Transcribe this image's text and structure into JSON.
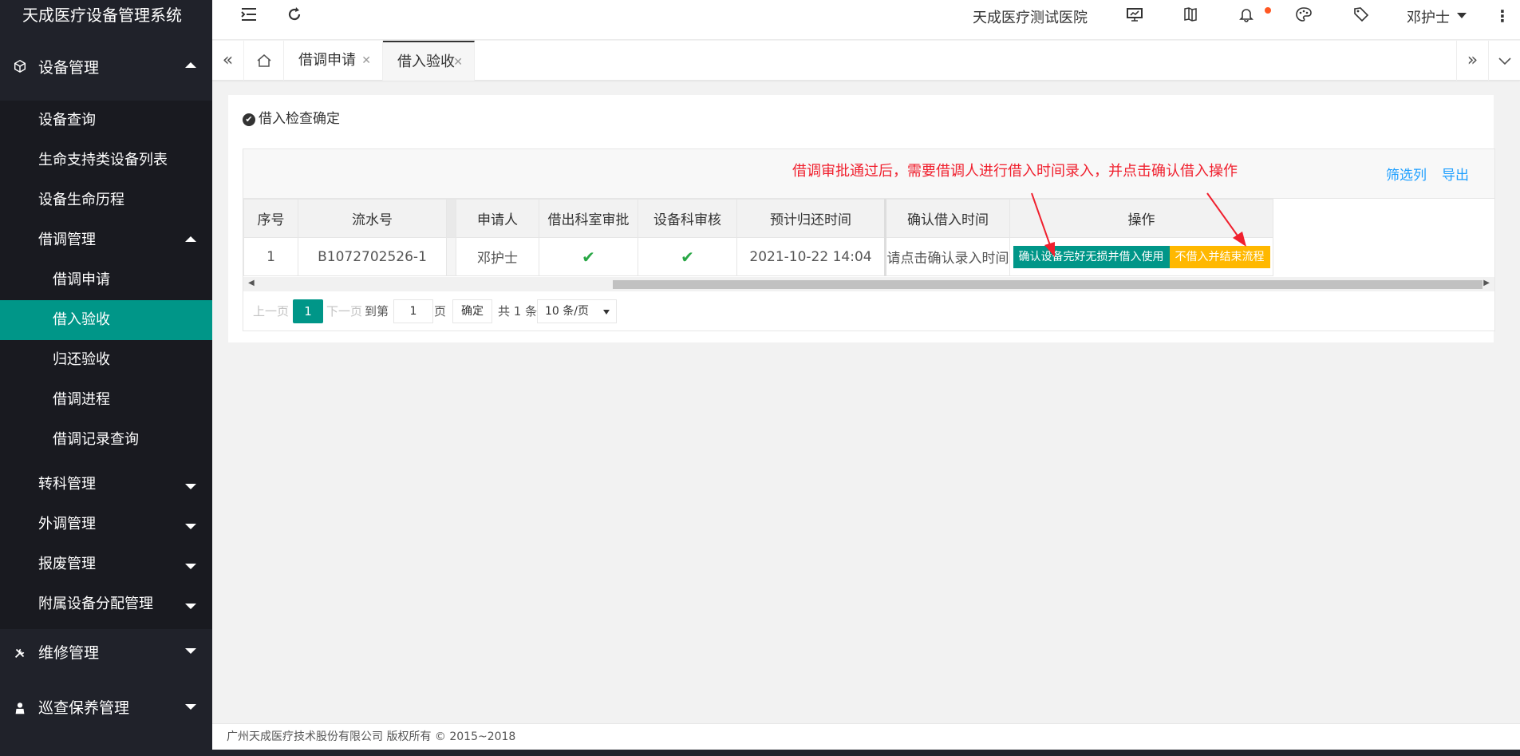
{
  "brand": "天成医疗设备管理系统",
  "colors": {
    "accent": "#009688",
    "warn": "#ffb800",
    "annotation": "#f0202e",
    "link": "#1e9fff"
  },
  "sidebar": {
    "groups": [
      {
        "label": "设备管理",
        "icon": "cube-icon",
        "expanded": true
      },
      {
        "label": "维修管理",
        "icon": "tools-icon",
        "expanded": false
      },
      {
        "label": "巡查保养管理",
        "icon": "person-icon",
        "expanded": false
      }
    ],
    "items": {
      "device_query": "设备查询",
      "life_support": "生命支持类设备列表",
      "lifecycle": "设备生命历程",
      "loan_mgmt": "借调管理",
      "loan_apply": "借调申请",
      "loan_accept": "借入验收",
      "return_accept": "归还验收",
      "loan_progress": "借调进程",
      "loan_records": "借调记录查询",
      "transfer_mgmt": "转科管理",
      "external_mgmt": "外调管理",
      "scrap_mgmt": "报废管理",
      "accessory_mgmt": "附属设备分配管理"
    }
  },
  "header": {
    "hospital": "天成医疗测试医院",
    "user": "邓护士"
  },
  "tabs": {
    "t1": "借调申请",
    "t2": "借入验收"
  },
  "panel": {
    "title": "借入检查确定",
    "annotation": "借调审批通过后，需要借调人进行借入时间录入，并点击确认借入操作",
    "filter": "筛选列",
    "export": "导出",
    "columns": {
      "seq": "序号",
      "serial": "流水号",
      "applicant": "申请人",
      "dept_approve": "借出科室审批",
      "equip_review": "设备科审核",
      "return_time": "预计归还时间",
      "confirm_time": "确认借入时间",
      "action": "操作"
    },
    "rows": [
      {
        "seq": "1",
        "serial": "B1072702526-1",
        "applicant": "邓护士",
        "return_time": "2021-10-22 14:04",
        "confirm_time": "请点击确认录入时间",
        "btn_confirm": "确认设备完好无损并借入使用",
        "btn_reject": "不借入并结束流程"
      }
    ]
  },
  "pager": {
    "prev": "上一页",
    "current": "1",
    "next": "下一页",
    "goto": "到第",
    "page_value": "1",
    "page_unit": "页",
    "confirm": "确定",
    "total": "共 1 条",
    "per_page": "10 条/页"
  },
  "footer": "广州天成医疗技术股份有限公司 版权所有 © 2015~2018"
}
